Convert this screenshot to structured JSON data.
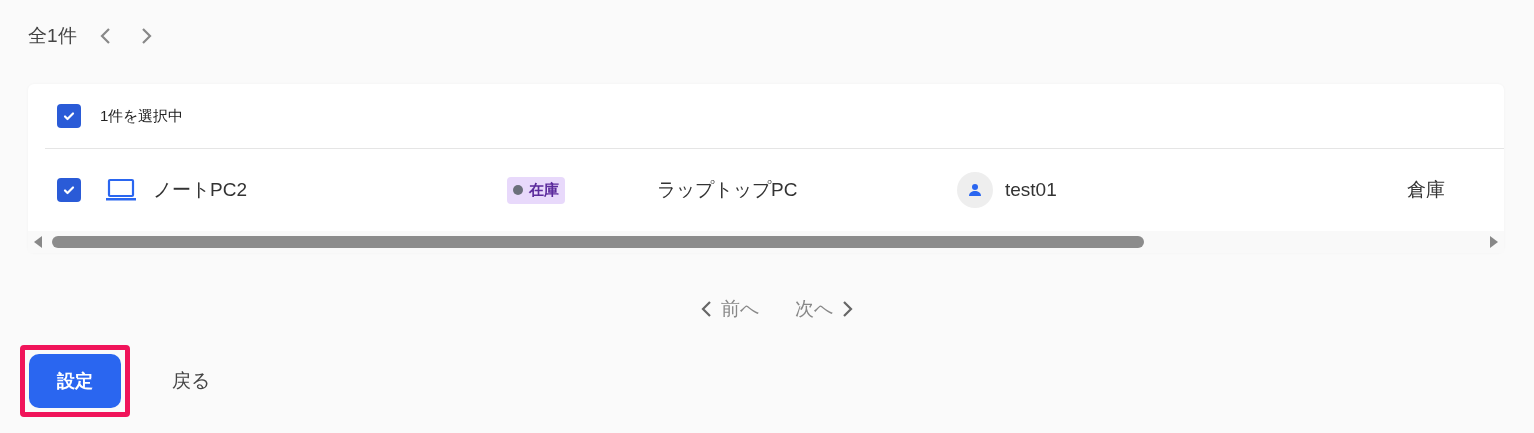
{
  "summary": {
    "count": "全1件"
  },
  "table": {
    "header": {
      "checked": true,
      "label": "1件を選択中"
    },
    "rows": [
      {
        "checked": true,
        "name": "ノートPC2",
        "status": "在庫",
        "type": "ラップトップPC",
        "user": "test01",
        "location": "倉庫"
      }
    ]
  },
  "pager": {
    "prev": "前へ",
    "next": "次へ"
  },
  "actions": {
    "primary": "設定",
    "secondary": "戻る",
    "highlighted": true
  }
}
